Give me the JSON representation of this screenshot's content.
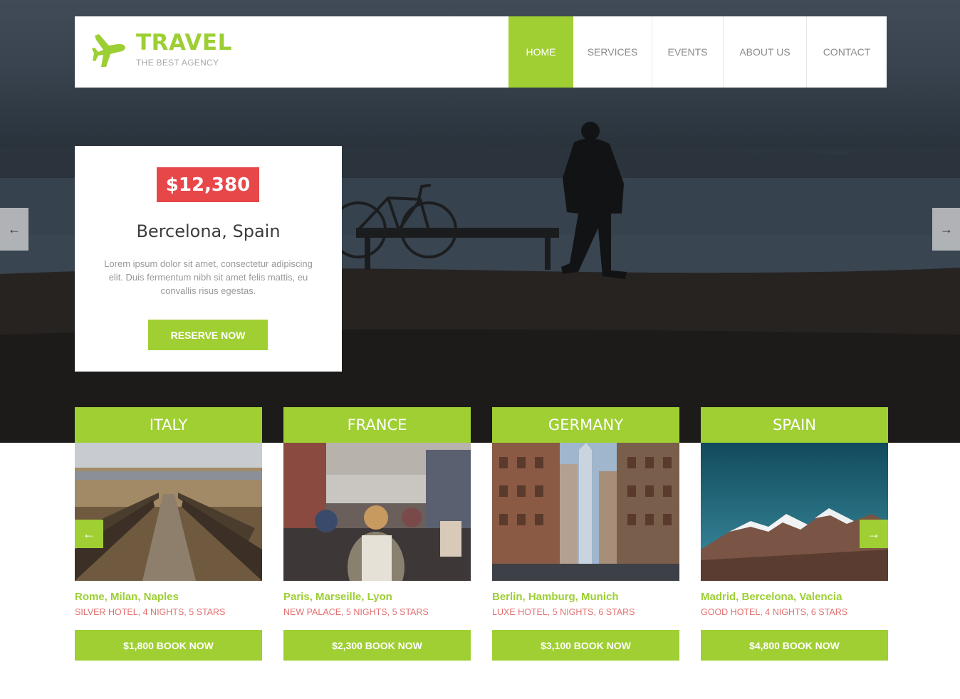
{
  "brand": {
    "title": "TRAVEL",
    "tagline": "THE BEST AGENCY",
    "icon": "airplane-icon",
    "accent_color": "#a0cf34",
    "price_color": "#e8474a"
  },
  "nav": {
    "items": [
      {
        "label": "HOME",
        "active": true
      },
      {
        "label": "SERVICES",
        "active": false
      },
      {
        "label": "EVENTS",
        "active": false
      },
      {
        "label": "ABOUT US",
        "active": false
      },
      {
        "label": "CONTACT",
        "active": false
      }
    ]
  },
  "hero": {
    "prev_arrow": "←",
    "next_arrow": "→",
    "offer": {
      "price": "$12,380",
      "title": "Bercelona, Spain",
      "description": "Lorem ipsum dolor sit amet, consectetur adipiscing elit. Duis fermentum nibh sit amet felis mattis, eu convallis risus egestas.",
      "button": "RESERVE NOW"
    }
  },
  "destinations": {
    "prev_arrow": "←",
    "next_arrow": "→",
    "cards": [
      {
        "country": "ITALY",
        "cities": "Rome, Milan, Naples",
        "hotel": "SILVER HOTEL, 4 NIGHTS, 5 STARS",
        "button": "$1,800 BOOK NOW"
      },
      {
        "country": "FRANCE",
        "cities": "Paris, Marseille, Lyon",
        "hotel": "NEW PALACE, 5 NIGHTS, 5 STARS",
        "button": "$2,300 BOOK NOW"
      },
      {
        "country": "GERMANY",
        "cities": "Berlin, Hamburg, Munich",
        "hotel": "LUXE HOTEL, 5 NIGHTS, 6 STARS",
        "button": "$3,100 BOOK NOW"
      },
      {
        "country": "SPAIN",
        "cities": "Madrid, Bercelona, Valencia",
        "hotel": "GOOD HOTEL, 4 NIGHTS, 6 STARS",
        "button": "$4,800 BOOK NOW"
      }
    ]
  }
}
